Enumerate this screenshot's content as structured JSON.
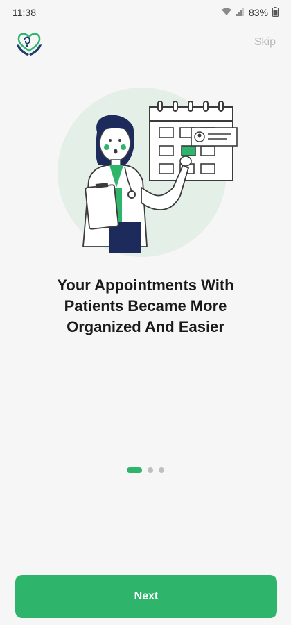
{
  "status_bar": {
    "time": "11:38",
    "battery": "83%",
    "icons": [
      "wifi-icon",
      "signal-icon"
    ]
  },
  "header": {
    "logo_icon": "heart-hands-logo-icon",
    "skip_label": "Skip"
  },
  "onboarding": {
    "illustration": "doctor-calendar-illustration",
    "headline_lines": [
      "Your Appointments With",
      "Patients Became More",
      "Organized And Easier"
    ],
    "page_indicator": {
      "current": 1,
      "total": 3
    }
  },
  "footer": {
    "next_label": "Next"
  },
  "colors": {
    "accent": "#2fb56b",
    "logo_navy": "#1d3c6e",
    "background": "#f6f6f6",
    "circle": "#e4efe7"
  }
}
